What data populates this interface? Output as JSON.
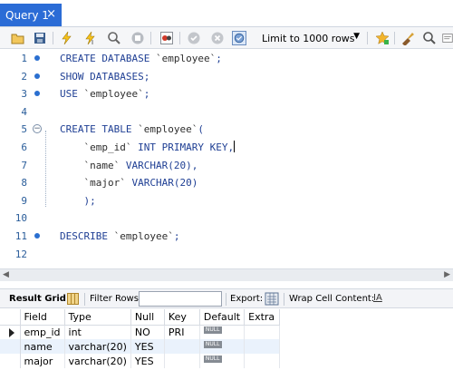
{
  "tab": {
    "title": "Query 1",
    "close": "×"
  },
  "toolbar": {
    "limit_label": "Limit to 1000 rows",
    "icons": [
      "open-file",
      "save",
      "execute",
      "execute-current",
      "explain",
      "stop",
      "toggle-continue",
      "commit",
      "rollback",
      "autocommit",
      "beautify",
      "find",
      "wrap"
    ]
  },
  "editor": {
    "lines": [
      {
        "n": "1",
        "marker": "dot",
        "parts": [
          [
            "kw",
            "CREATE DATABASE "
          ],
          [
            "str",
            "`employee`"
          ],
          [
            "kw",
            ";"
          ]
        ]
      },
      {
        "n": "2",
        "marker": "dot",
        "parts": [
          [
            "kw",
            "SHOW DATABASES;"
          ]
        ]
      },
      {
        "n": "3",
        "marker": "dot",
        "parts": [
          [
            "kw",
            "USE "
          ],
          [
            "str",
            "`employee`"
          ],
          [
            "kw",
            ";"
          ]
        ]
      },
      {
        "n": "4",
        "marker": "",
        "parts": []
      },
      {
        "n": "5",
        "marker": "fold",
        "parts": [
          [
            "kw",
            "CREATE TABLE "
          ],
          [
            "str",
            "`employee`"
          ],
          [
            "kw",
            "("
          ]
        ]
      },
      {
        "n": "6",
        "marker": "",
        "parts": [
          [
            "str",
            "    `emp_id`"
          ],
          [
            "kw",
            " INT PRIMARY KEY,"
          ]
        ],
        "caret": true
      },
      {
        "n": "7",
        "marker": "",
        "parts": [
          [
            "str",
            "    `name`"
          ],
          [
            "kw",
            " VARCHAR(20),"
          ]
        ]
      },
      {
        "n": "8",
        "marker": "",
        "parts": [
          [
            "str",
            "    `major`"
          ],
          [
            "kw",
            " VARCHAR(20)"
          ]
        ]
      },
      {
        "n": "9",
        "marker": "",
        "parts": [
          [
            "kw",
            "    );"
          ]
        ]
      },
      {
        "n": "10",
        "marker": "",
        "parts": []
      },
      {
        "n": "11",
        "marker": "dot",
        "parts": [
          [
            "kw",
            "DESCRIBE "
          ],
          [
            "str",
            "`employee`"
          ],
          [
            "kw",
            ";"
          ]
        ]
      },
      {
        "n": "12",
        "marker": "",
        "parts": []
      }
    ]
  },
  "result_toolbar": {
    "result_grid": "Result Grid",
    "filter_rows": "Filter Rows:",
    "filter_value": "",
    "export": "Export:",
    "wrap_cell": "Wrap Cell Content:",
    "wrap_icon": "IA"
  },
  "result": {
    "columns": [
      "Field",
      "Type",
      "Null",
      "Key",
      "Default",
      "Extra"
    ],
    "rows": [
      {
        "Field": "emp_id",
        "Type": "int",
        "Null": "NO",
        "Key": "PRI",
        "Default": "NULL",
        "Extra": ""
      },
      {
        "Field": "name",
        "Type": "varchar(20)",
        "Null": "YES",
        "Key": "",
        "Default": "NULL",
        "Extra": ""
      },
      {
        "Field": "major",
        "Type": "varchar(20)",
        "Null": "YES",
        "Key": "",
        "Default": "NULL",
        "Extra": ""
      }
    ]
  }
}
